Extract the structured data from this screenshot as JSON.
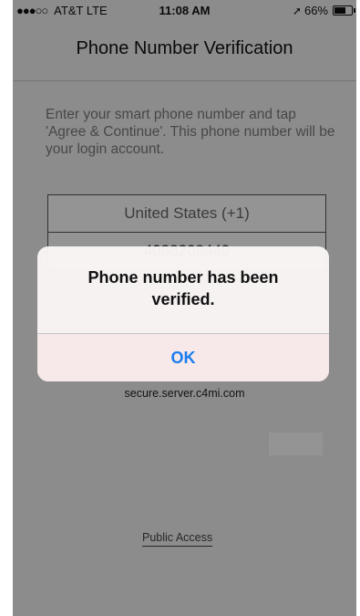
{
  "status_bar": {
    "signal": "●●●○○",
    "carrier": "AT&T",
    "network": "LTE",
    "time": "11:08 AM",
    "location_arrow": "➚",
    "battery_percent": "66%",
    "battery_level": 0.66
  },
  "nav": {
    "title": "Phone Number Verification"
  },
  "main": {
    "instructions": "Enter your smart phone number and tap 'Agree & Continue'. This phone number will be your login account.",
    "country": "United States (+1)",
    "phone_number": "4088208449",
    "server": "secure.server.c4mi.com",
    "public_access": "Public Access"
  },
  "alert": {
    "message": "Phone number has been verified.",
    "ok_label": "OK"
  },
  "colors": {
    "accent": "#1a7df0",
    "dim_overlay": "rgba(0,0,0,0.42)",
    "alert_button_bg": "#f7e8e9"
  },
  "icons": [
    "signal-dots-icon",
    "location-arrow-icon",
    "battery-icon"
  ]
}
